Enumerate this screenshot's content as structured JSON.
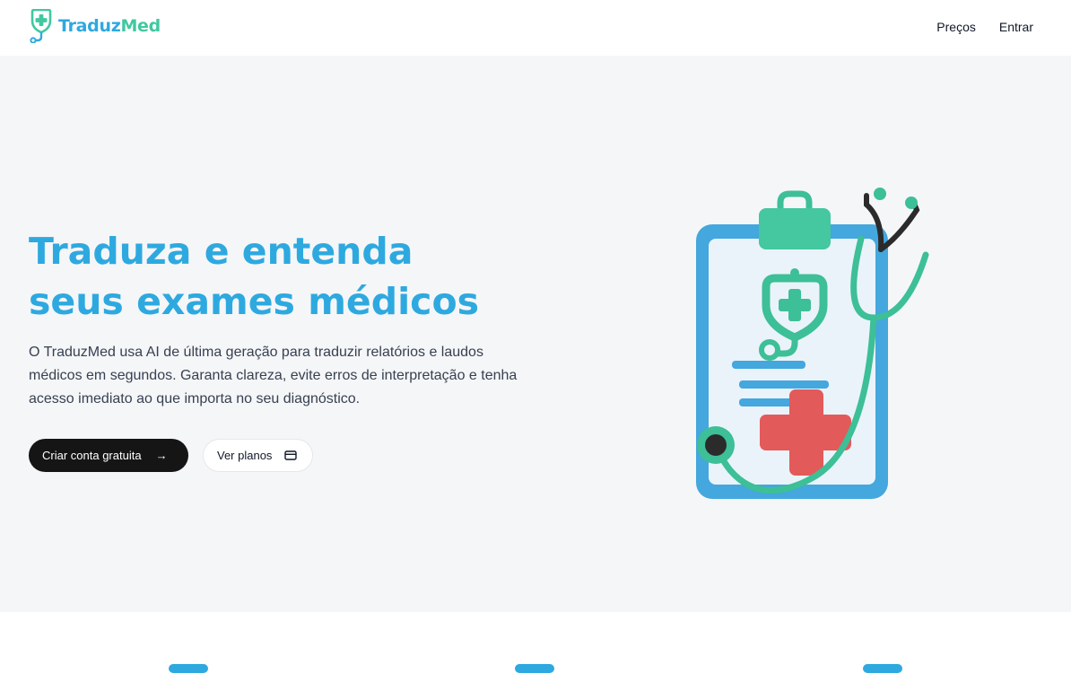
{
  "brand": {
    "name_part1": "Traduz",
    "name_part2": "Med"
  },
  "nav": {
    "pricing": "Preços",
    "login": "Entrar"
  },
  "hero": {
    "title_line1": "Traduza e entenda",
    "title_line2": "seus exames médicos",
    "description": "O TraduzMed usa AI de última geração para traduzir relatórios e laudos médicos em segundos. Garanta clareza, evite erros de interpretação e tenha acesso imediato ao que importa no seu diagnóstico.",
    "primary_cta": "Criar conta gratuita",
    "secondary_cta": "Ver planos"
  },
  "colors": {
    "brand_blue": "#2ea9e0",
    "brand_green": "#41c8a0",
    "button_dark": "#151515",
    "hero_background": "#f5f6f8",
    "cross_red": "#e35a5a"
  },
  "icons": {
    "logo": "stethoscope-shield-plus-icon",
    "primary_cta": "arrow-right-icon",
    "secondary_cta": "credit-card-icon",
    "illustration": "clipboard-stethoscope-illustration"
  }
}
